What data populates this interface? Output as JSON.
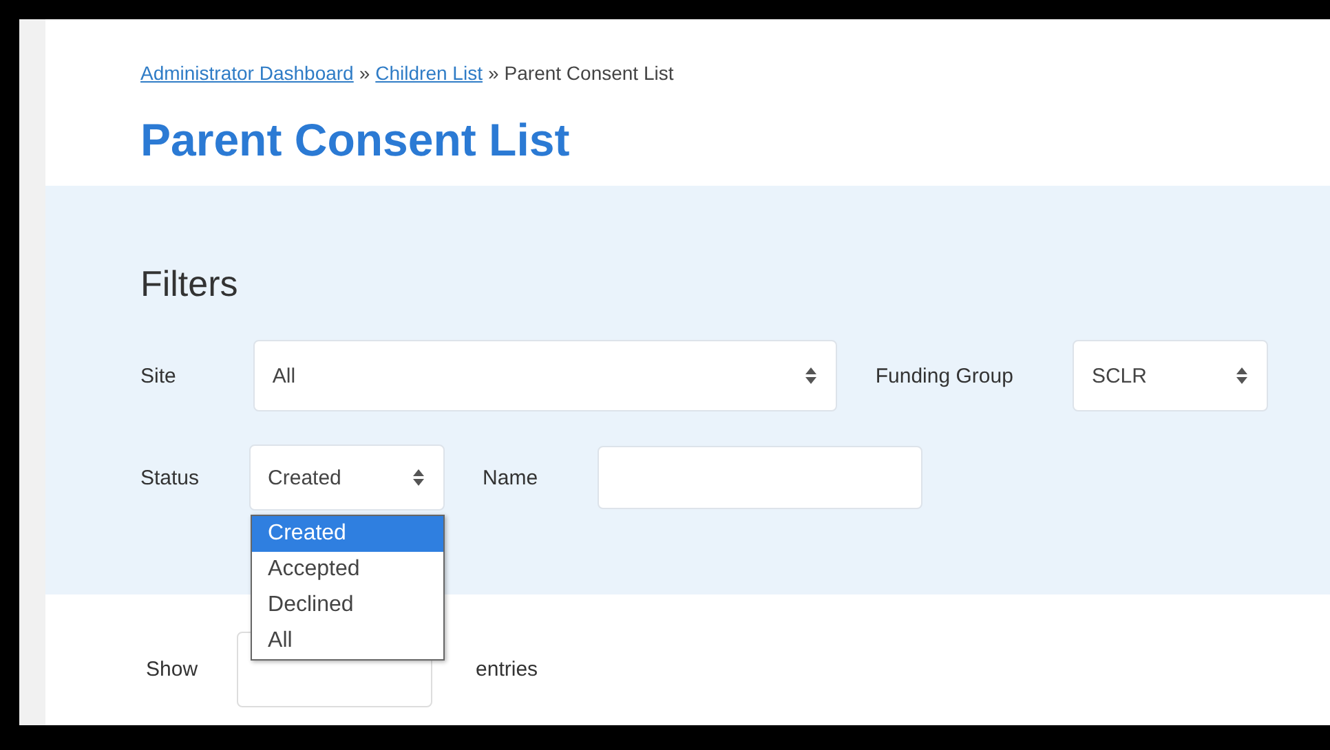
{
  "breadcrumb": [
    {
      "label": "Administrator Dashboard",
      "kind": "link"
    },
    {
      "label": "Children List",
      "kind": "link"
    },
    {
      "label": "Parent Consent List",
      "kind": "current"
    }
  ],
  "breadcrumb_separator": "»",
  "title": "Parent Consent List",
  "filters": {
    "title": "Filters",
    "rows": [
      [
        {
          "label": "Site",
          "kind": "select",
          "value": "All"
        },
        {
          "label": "Funding Group",
          "kind": "select",
          "value": "SCLR"
        }
      ],
      [
        {
          "label": "Status",
          "kind": "select",
          "value": "Created",
          "options": [
            {
              "label": "Created",
              "selected": true
            },
            {
              "label": "Accepted",
              "selected": false
            },
            {
              "label": "Declined",
              "selected": false
            },
            {
              "label": "All",
              "selected": false
            }
          ]
        },
        {
          "label": "Name",
          "kind": "text"
        }
      ]
    ]
  },
  "entries": {
    "before": "Show",
    "after": "entries"
  }
}
